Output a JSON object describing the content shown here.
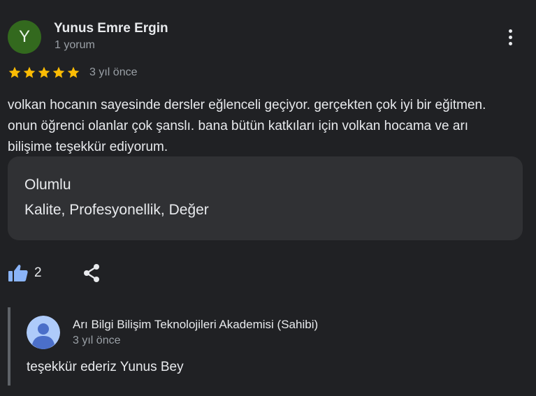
{
  "review": {
    "author": {
      "initial": "Y",
      "name": "Yunus Emre Ergin",
      "meta": "1 yorum",
      "avatar_color": "#33691e"
    },
    "rating": 5,
    "time": "3 yıl önce",
    "text": "volkan hocanın sayesinde dersler eğlenceli geçiyor. gerçekten çok iyi bir eğitmen. onun öğrenci olanlar çok şanslı. bana bütün katkıları için volkan hocama ve arı bilişime teşekkür ediyorum.",
    "highlight": {
      "title": "Olumlu",
      "values": "Kalite, Profesyonellik, Değer"
    },
    "likes": "2"
  },
  "reply": {
    "author": "Arı Bilgi Bilişim Teknolojileri Akademisi (Sahibi)",
    "time": "3 yıl önce",
    "text": "teşekkür ederiz Yunus Bey"
  },
  "colors": {
    "background": "#202124",
    "star": "#fbbc04",
    "thumb": "#8ab4f8",
    "card": "#303134"
  },
  "icons": {
    "more": "more-vert-icon",
    "like": "thumb-up-icon",
    "share": "share-icon",
    "star": "star-icon",
    "reply_avatar": "default-avatar-icon"
  }
}
